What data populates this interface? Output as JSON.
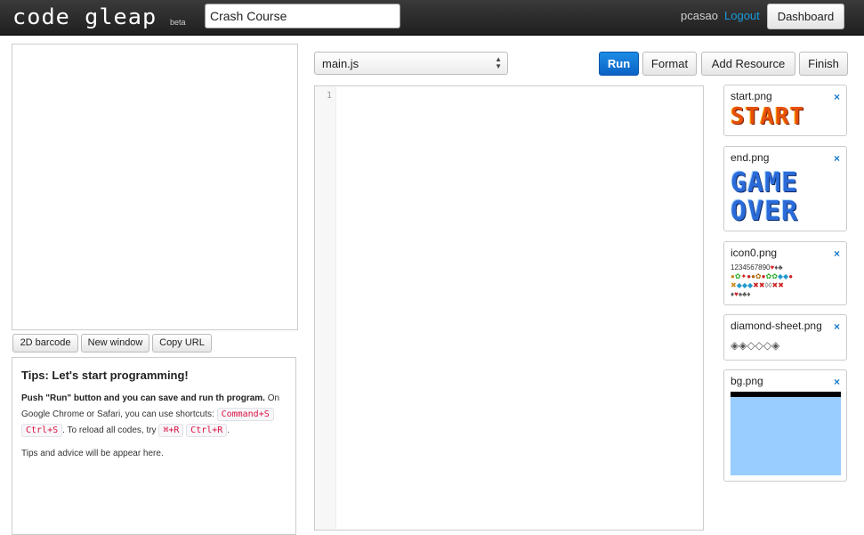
{
  "header": {
    "logo_text": "code gleap",
    "beta": "beta",
    "project_name": "Crash Course",
    "username": "pcasao",
    "logout": "Logout",
    "dashboard": "Dashboard"
  },
  "preview_buttons": {
    "barcode": "2D barcode",
    "new_window": "New window",
    "copy_url": "Copy URL"
  },
  "tips": {
    "title": "Tips: Let's start programming!",
    "p1_bold": "Push \"Run\" button and you can save and run th program.",
    "p1_text": " On Google Chrome or Safari, you can use shortcuts: ",
    "shortcut_mac": "Command+S",
    "shortcut_win": "Ctrl+S",
    "reload_text": ". To reload all codes, try ",
    "reload_mac": "⌘+R",
    "reload_win": "Ctrl+R",
    "end": ".",
    "p2": "Tips and advice will be appear here."
  },
  "editor": {
    "file": "main.js",
    "line_number": "1",
    "buttons": {
      "run": "Run",
      "format": "Format",
      "add_resource": "Add Resource",
      "finish": "Finish"
    }
  },
  "resources": [
    {
      "name": "start.png",
      "image_text": "START"
    },
    {
      "name": "end.png",
      "image_text_line1": "GAME",
      "image_text_line2": "OVER"
    },
    {
      "name": "icon0.png",
      "image_text": "1234567890"
    },
    {
      "name": "diamond-sheet.png"
    },
    {
      "name": "bg.png"
    }
  ],
  "colors": {
    "topbar": "#2b2b2b",
    "accent_link": "#1a9bdc",
    "run_button": "#0b6fd6",
    "bg_preview": "#99ccff"
  },
  "icons": {
    "close": "close-x-icon",
    "select": "select-arrows-icon"
  }
}
